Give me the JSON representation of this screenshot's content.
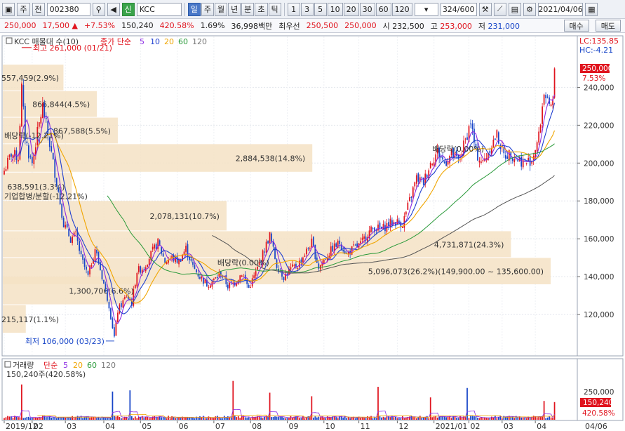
{
  "toolbar": {
    "mode_label": "주",
    "prefix_label": "전",
    "code": "002380",
    "name": "KCC",
    "credit_label": "신",
    "periods": [
      "일",
      "주",
      "월",
      "년",
      "분",
      "초",
      "틱"
    ],
    "active_period": "일",
    "intervals": [
      "1",
      "3",
      "5",
      "10",
      "20",
      "30",
      "60",
      "120"
    ],
    "count": "324/600",
    "date": "2021/04/06"
  },
  "quote": {
    "price": "250,000",
    "change": "17,500",
    "change_pct": "+7.53%",
    "volume": "150,240",
    "volume_pct": "420.58%",
    "turnover_pct": "1.69%",
    "amount": "36,998백만",
    "best_label": "최우선",
    "best_ask": "250,500",
    "best_bid": "250,000",
    "open_label": "시",
    "open": "232,500",
    "high_label": "고",
    "high": "253,000",
    "low_label": "저",
    "low": "231,000",
    "buy_label": "매수",
    "sell_label": "매도"
  },
  "chart_data": {
    "type": "candlestick",
    "legend_title": "KCC 매물대 수(10)",
    "ma_legend": {
      "label": "종가 단순",
      "periods": [
        "5",
        "10",
        "20",
        "60",
        "120"
      ]
    },
    "price_axis": {
      "min": 100000,
      "max": 265000,
      "ticks": [
        "240,000",
        "220,000",
        "200,000",
        "180,000",
        "160,000",
        "140,000",
        "120,000"
      ],
      "tick_values": [
        240000,
        220000,
        200000,
        180000,
        160000,
        140000,
        120000
      ]
    },
    "current_price_label": "250,000",
    "current_change_label": "7.53%",
    "lc_label": "LC:135.85",
    "hc_label": "HC:-4.21",
    "x_labels": [
      "2019/12",
      "02",
      "03",
      "04",
      "05",
      "06",
      "07",
      "08",
      "09",
      "10",
      "11",
      "12",
      "2021/01",
      "02",
      "03",
      "04"
    ],
    "x_label_day": [
      0,
      16,
      35,
      57,
      78,
      99,
      120,
      141,
      162,
      183,
      203,
      225,
      246,
      266,
      285,
      304
    ],
    "total_days": 320,
    "last_date_label": "04/06",
    "high_marker": {
      "label": "최고 261,000 (01/21)",
      "day": 10,
      "value": 261000
    },
    "low_marker": {
      "label": "최저 106,000 (03/23)",
      "day": 63,
      "value": 106000
    },
    "volume_profile": [
      {
        "label": "215,117(1.1%)",
        "low": 110000,
        "high": 125000,
        "share": 1.1
      },
      {
        "label": "1,300,706(6.6%)",
        "low": 125000,
        "high": 140000,
        "share": 6.6
      },
      {
        "label": "5,096,073(26.2%)(149,900.00 ~ 135,600.00)",
        "low": 135600,
        "high": 149900,
        "share": 26.2
      },
      {
        "label": "4,731,871(24.3%)",
        "low": 149900,
        "high": 164000,
        "share": 24.3
      },
      {
        "label": "2,078,131(10.7%)",
        "low": 164000,
        "high": 180000,
        "share": 10.7
      },
      {
        "label": "638,591(3.3%)",
        "low": 180000,
        "high": 195000,
        "share": 3.3
      },
      {
        "label": "2,884,538(14.8%)",
        "low": 195000,
        "high": 210000,
        "share": 14.8
      },
      {
        "label": "867,588(5.5%)",
        "low": 210000,
        "high": 224000,
        "share": 5.5
      },
      {
        "label": "866,844(4.5%)",
        "low": 224000,
        "high": 238000,
        "share": 4.5
      },
      {
        "label": "557,459(2.9%)",
        "low": 238000,
        "high": 252000,
        "share": 2.9
      }
    ],
    "annotations": [
      {
        "label": "배당락(-12.21%)",
        "day": 0,
        "value": 213000
      },
      {
        "label": "기업합병/분할(-12.21%)",
        "day": 0,
        "value": 181000
      },
      {
        "label": "배당락(0.00%)",
        "day": 122,
        "value": 146000
      },
      {
        "label": "배당락(0.00%)",
        "day": 245,
        "value": 206000
      }
    ],
    "anchors": [
      {
        "day": 0,
        "v": 196000
      },
      {
        "day": 4,
        "v": 205000
      },
      {
        "day": 8,
        "v": 203000
      },
      {
        "day": 10,
        "v": 240000
      },
      {
        "day": 12,
        "v": 214000
      },
      {
        "day": 14,
        "v": 205000
      },
      {
        "day": 16,
        "v": 200000
      },
      {
        "day": 19,
        "v": 216000
      },
      {
        "day": 22,
        "v": 230000
      },
      {
        "day": 25,
        "v": 215000
      },
      {
        "day": 28,
        "v": 200000
      },
      {
        "day": 31,
        "v": 185000
      },
      {
        "day": 34,
        "v": 168000
      },
      {
        "day": 38,
        "v": 160000
      },
      {
        "day": 41,
        "v": 162000
      },
      {
        "day": 44,
        "v": 150000
      },
      {
        "day": 48,
        "v": 140000
      },
      {
        "day": 52,
        "v": 155000
      },
      {
        "day": 56,
        "v": 140000
      },
      {
        "day": 60,
        "v": 125000
      },
      {
        "day": 63,
        "v": 108000
      },
      {
        "day": 65,
        "v": 122000
      },
      {
        "day": 70,
        "v": 130000
      },
      {
        "day": 73,
        "v": 126000
      },
      {
        "day": 76,
        "v": 143000
      },
      {
        "day": 80,
        "v": 145000
      },
      {
        "day": 84,
        "v": 152000
      },
      {
        "day": 88,
        "v": 158000
      },
      {
        "day": 92,
        "v": 148000
      },
      {
        "day": 96,
        "v": 150000
      },
      {
        "day": 100,
        "v": 148000
      },
      {
        "day": 104,
        "v": 155000
      },
      {
        "day": 108,
        "v": 145000
      },
      {
        "day": 112,
        "v": 140000
      },
      {
        "day": 116,
        "v": 136000
      },
      {
        "day": 120,
        "v": 138000
      },
      {
        "day": 124,
        "v": 142000
      },
      {
        "day": 128,
        "v": 135000
      },
      {
        "day": 132,
        "v": 137000
      },
      {
        "day": 136,
        "v": 142000
      },
      {
        "day": 140,
        "v": 134000
      },
      {
        "day": 144,
        "v": 142000
      },
      {
        "day": 148,
        "v": 152000
      },
      {
        "day": 152,
        "v": 162000
      },
      {
        "day": 156,
        "v": 146000
      },
      {
        "day": 160,
        "v": 140000
      },
      {
        "day": 164,
        "v": 144000
      },
      {
        "day": 168,
        "v": 146000
      },
      {
        "day": 172,
        "v": 152000
      },
      {
        "day": 176,
        "v": 158000
      },
      {
        "day": 180,
        "v": 145000
      },
      {
        "day": 184,
        "v": 150000
      },
      {
        "day": 188,
        "v": 155000
      },
      {
        "day": 192,
        "v": 158000
      },
      {
        "day": 196,
        "v": 152000
      },
      {
        "day": 200,
        "v": 155000
      },
      {
        "day": 204,
        "v": 157000
      },
      {
        "day": 208,
        "v": 163000
      },
      {
        "day": 212,
        "v": 166000
      },
      {
        "day": 216,
        "v": 165000
      },
      {
        "day": 220,
        "v": 168000
      },
      {
        "day": 224,
        "v": 169000
      },
      {
        "day": 228,
        "v": 168000
      },
      {
        "day": 232,
        "v": 180000
      },
      {
        "day": 236,
        "v": 192000
      },
      {
        "day": 240,
        "v": 190000
      },
      {
        "day": 244,
        "v": 200000
      },
      {
        "day": 248,
        "v": 206000
      },
      {
        "day": 252,
        "v": 200000
      },
      {
        "day": 256,
        "v": 205000
      },
      {
        "day": 260,
        "v": 201000
      },
      {
        "day": 264,
        "v": 212000
      },
      {
        "day": 267,
        "v": 222000
      },
      {
        "day": 270,
        "v": 205000
      },
      {
        "day": 274,
        "v": 200000
      },
      {
        "day": 278,
        "v": 208000
      },
      {
        "day": 282,
        "v": 215000
      },
      {
        "day": 286,
        "v": 204000
      },
      {
        "day": 290,
        "v": 205000
      },
      {
        "day": 294,
        "v": 202000
      },
      {
        "day": 298,
        "v": 200000
      },
      {
        "day": 302,
        "v": 202000
      },
      {
        "day": 306,
        "v": 214000
      },
      {
        "day": 309,
        "v": 238000
      },
      {
        "day": 312,
        "v": 228000
      },
      {
        "day": 314,
        "v": 232500
      },
      {
        "day": 315,
        "v": 250000
      }
    ],
    "volume_panel": {
      "title": "거래량",
      "ma_label": "단순",
      "ma_periods": [
        "5",
        "20",
        "60",
        "120"
      ],
      "current_label": "150,240주(420.58%)",
      "axis_label": "250,000",
      "current_value_label": "150,240",
      "current_pct_label": "420.58%",
      "max": 340000,
      "spikes": [
        {
          "day": 10,
          "v": 300000
        },
        {
          "day": 62,
          "v": 240000
        },
        {
          "day": 72,
          "v": 250000
        },
        {
          "day": 131,
          "v": 330000
        },
        {
          "day": 152,
          "v": 230000
        },
        {
          "day": 176,
          "v": 200000
        },
        {
          "day": 214,
          "v": 280000
        },
        {
          "day": 244,
          "v": 190000
        },
        {
          "day": 265,
          "v": 270000
        },
        {
          "day": 309,
          "v": 160000
        },
        {
          "day": 315,
          "v": 150240
        }
      ]
    }
  },
  "colors": {
    "up": "#e0141e",
    "down": "#1745c8",
    "profile": "#f5e2c4",
    "ma5": "#8a2be2",
    "ma10": "#1f3fd0",
    "ma20": "#f0a500",
    "ma60": "#2a9a3a",
    "ma120": "#555555"
  }
}
